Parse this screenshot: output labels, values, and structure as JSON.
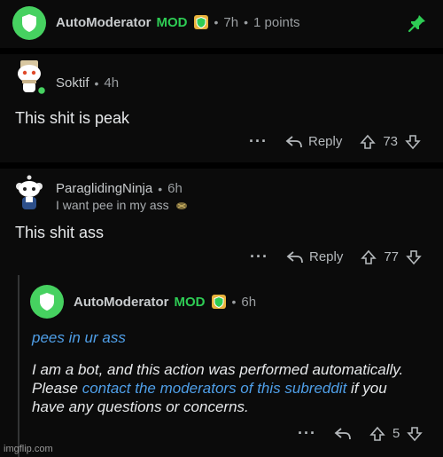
{
  "comments": {
    "automod_top": {
      "username": "AutoModerator",
      "mod_badge": "MOD",
      "time": "7h",
      "points": "1 points"
    },
    "soktif": {
      "username": "Soktif",
      "time": "4h",
      "body": "This shit is peak",
      "reply_label": "Reply",
      "votes": "73"
    },
    "ninja": {
      "username": "ParaglidingNinja",
      "time": "6h",
      "flair": "I want pee in my ass",
      "body": "This shit ass",
      "reply_label": "Reply",
      "votes": "77"
    },
    "automod_reply": {
      "username": "AutoModerator",
      "mod_badge": "MOD",
      "time": "6h",
      "line1": "pees in ur ass",
      "text_a": "I am a bot, and this action was performed automatically. Please ",
      "link_text": "contact the moderators of this subreddit",
      "text_b": " if you have any questions or concerns.",
      "votes": "5"
    }
  },
  "watermark": "imgflip.com",
  "colors": {
    "mod_green": "#2ecc54",
    "link_blue": "#4f9fe8",
    "background": "#0b0b0b"
  }
}
